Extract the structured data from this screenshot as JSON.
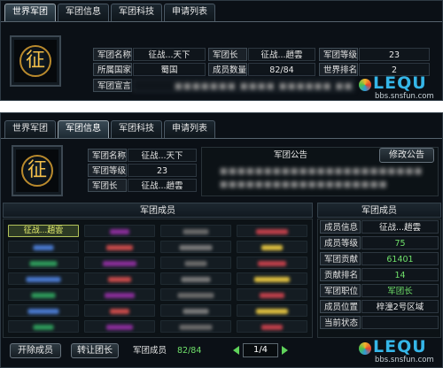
{
  "tabs": [
    "世界军团",
    "军团信息",
    "军团科技",
    "申请列表"
  ],
  "emblem_char": "征",
  "top": {
    "name_label": "军团名称",
    "name_value": "征战...天下",
    "leader_label": "军团长",
    "leader_value": "征战...趙雲",
    "level_label": "军团等级",
    "level_value": "23",
    "country_label": "所属国家",
    "country_value": "蜀国",
    "members_label": "成员数量",
    "members_value": "82/84",
    "rank_label": "世界排名",
    "rank_value": "2",
    "motto_label": "军团宣言",
    "motto_value": "■■■■■■■ ■■■■ ■■■■■■ ■■■■■■■■ ■■■■■"
  },
  "bottom": {
    "name_label": "军团名称",
    "name_value": "征战...天下",
    "level_label": "军团等级",
    "level_value": "23",
    "leader_label": "军团长",
    "leader_value": "征战...趙雲",
    "notice_title": "军团公告",
    "notice_edit_button": "修改公告",
    "notice_line1": "■■■■■■■■■■■■■■■■■■■■■■■■■■■",
    "notice_line2": "■■■■■■■■■■■■■■■■■■■",
    "member_list_title": "军团成员",
    "selected_member": "征战...趙雲",
    "member_info_title": "军团成员",
    "info": [
      {
        "label": "成员信息",
        "value": "征战...趙雲"
      },
      {
        "label": "成员等级",
        "value": "75"
      },
      {
        "label": "军团贡献",
        "value": "61401"
      },
      {
        "label": "贡献排名",
        "value": "14"
      },
      {
        "label": "军团职位",
        "value": "军团长"
      },
      {
        "label": "成员位置",
        "value": "梓潼2号区域"
      },
      {
        "label": "当前状态",
        "value": ""
      }
    ],
    "kick_button": "开除成员",
    "transfer_button": "转让团长",
    "members_label": "军团成员",
    "members_count": "82/84",
    "page": "1/4"
  },
  "watermark": {
    "logo": "LEQU",
    "url": "bbs.snsfun.com"
  },
  "colors": {
    "accent_green": "#6fe06a",
    "logo_blue": "#35b6e8",
    "emblem_gold": "#f3c04a"
  }
}
